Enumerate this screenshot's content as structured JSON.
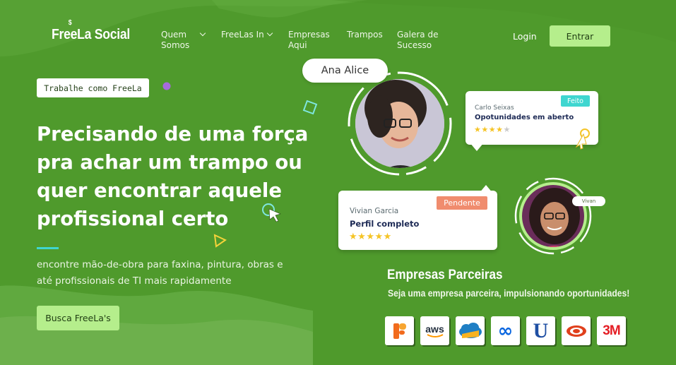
{
  "brand": {
    "name": "FreeLa Social",
    "symbol": "$"
  },
  "nav": {
    "items": [
      {
        "label": "Quem Somos",
        "line1": "Quem",
        "line2": "Somos",
        "dropdown": true
      },
      {
        "label": "FreeLas In",
        "dropdown": true
      },
      {
        "label": "Empresas Aqui",
        "line1": "Empresas",
        "line2": "Aqui",
        "dropdown": false
      },
      {
        "label": "Trampos",
        "dropdown": false
      },
      {
        "label": "Galera de Sucesso",
        "line1": "Galera de",
        "line2": "Sucesso",
        "dropdown": false
      }
    ],
    "login": "Login",
    "cta": "Entrar"
  },
  "hero": {
    "tag": "Trabalhe como  FreeLa",
    "headline": "Precisando de uma força pra achar um trampo ou quer encontrar aquele profissional certo",
    "subtitle": "encontre mão-de-obra para faxina, pintura, obras e até profissionais de TI mais rapidamente",
    "cta": "Busca FreeLa's"
  },
  "profiles": {
    "featured_name": "Ana Alice",
    "card1": {
      "name": "Carlo Seixas",
      "role": "Opotunidades em aberto",
      "status": "Feito",
      "rating": 4,
      "max": 5
    },
    "card2": {
      "name": "Vivian Garcia",
      "role": "Perfil completo",
      "status": "Pendente",
      "rating": 5,
      "max": 5
    },
    "small_label": "Vivan"
  },
  "partners": {
    "title": "Empresas Parceiras",
    "subtitle": "Seja uma empresa parceira, impulsionando oportunidades!",
    "logos": [
      {
        "name": "ifood-style-logo",
        "text": ""
      },
      {
        "name": "aws-logo",
        "text": "aws"
      },
      {
        "name": "salesforce-cloud-logo",
        "text": ""
      },
      {
        "name": "meta-logo",
        "text": "∞"
      },
      {
        "name": "unilever-logo",
        "text": "U"
      },
      {
        "name": "target-logo",
        "text": ""
      },
      {
        "name": "3m-logo",
        "text": "3M"
      }
    ]
  },
  "colors": {
    "background": "#4f9a2c",
    "accent_button": "#b5ee8c",
    "status_done": "#3fd6d0",
    "status_pending": "#f08c6e",
    "star": "#f5c426",
    "line_accent": "#3fd6d0"
  }
}
